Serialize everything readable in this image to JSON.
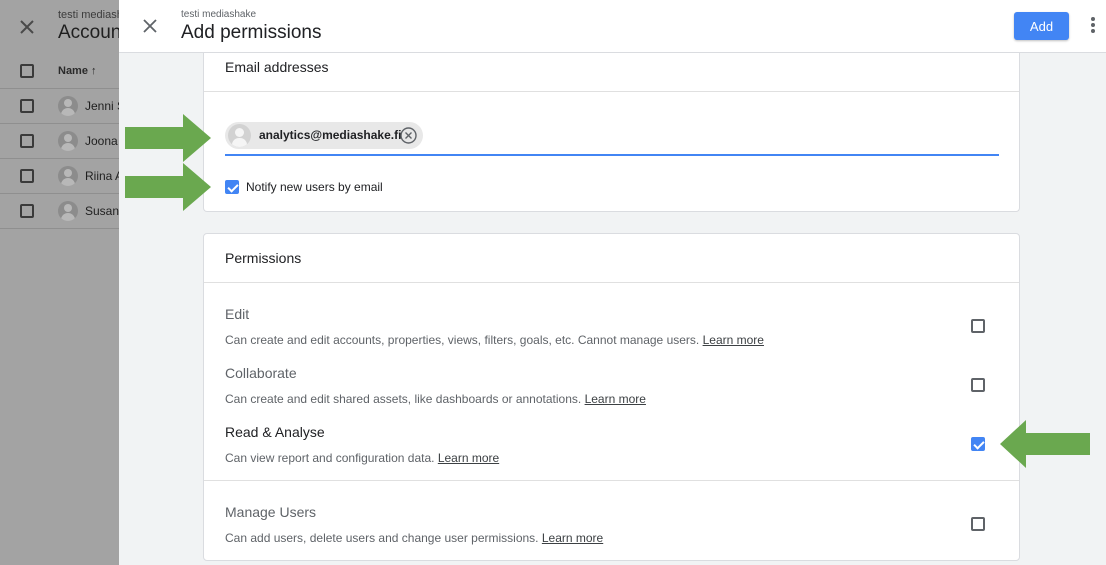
{
  "background": {
    "account_subtitle": "testi mediashake",
    "page_title": "Accounts",
    "name_column_header": "Name ↑",
    "users": [
      {
        "name": "Jenni S"
      },
      {
        "name": "Joona"
      },
      {
        "name": "Riina A"
      },
      {
        "name": "Susan"
      }
    ]
  },
  "panel": {
    "subtitle": "testi mediashake",
    "title": "Add permissions",
    "add_button": "Add",
    "close_icon": "close-icon",
    "more_icon": "more-vert-icon"
  },
  "email_section": {
    "heading": "Email addresses",
    "chip_email": "analytics@mediashake.fi",
    "notify_label": "Notify new users by email",
    "notify_checked": true
  },
  "permissions_section": {
    "heading": "Permissions",
    "items": [
      {
        "title": "Edit",
        "description": "Can create and edit accounts, properties, views, filters, goals, etc. Cannot manage users.",
        "link": "Learn more",
        "checked": false
      },
      {
        "title": "Collaborate",
        "description": "Can create and edit shared assets, like dashboards or annotations.",
        "link": "Learn more",
        "checked": false
      },
      {
        "title": "Read & Analyse",
        "description": "Can view report and configuration data.",
        "link": "Learn more",
        "checked": true
      },
      {
        "title": "Manage Users",
        "description": "Can add users, delete users and change user permissions.",
        "link": "Learn more",
        "checked": false
      }
    ]
  },
  "colors": {
    "accent": "#4285f4",
    "annotation_arrow": "#6aa84f"
  }
}
